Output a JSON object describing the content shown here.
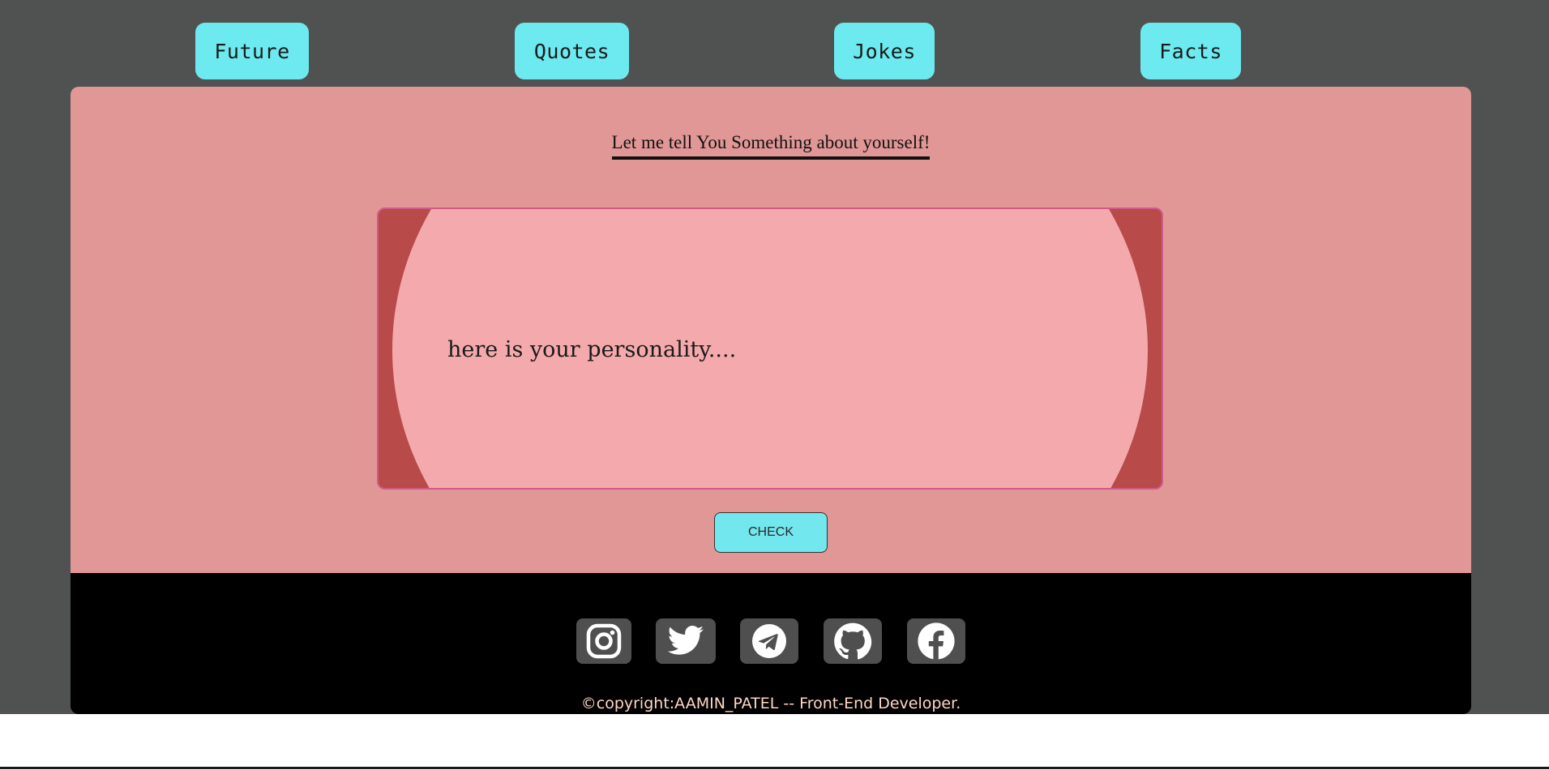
{
  "nav": {
    "items": [
      {
        "label": "Future"
      },
      {
        "label": "Quotes"
      },
      {
        "label": "Jokes"
      },
      {
        "label": "Facts"
      }
    ]
  },
  "main": {
    "heading": "Let me tell You Something about yourself!",
    "card_text": "here is your personality....",
    "check_label": "CHECK"
  },
  "footer": {
    "socials": [
      {
        "icon": "instagram-icon"
      },
      {
        "icon": "twitter-icon"
      },
      {
        "icon": "telegram-icon"
      },
      {
        "icon": "github-icon"
      },
      {
        "icon": "facebook-icon"
      }
    ],
    "copyright": "©copyright:AAMIN_PATEL -- Front-End Developer."
  },
  "colors": {
    "page_bg": "#505151",
    "nav_button": "#6ceaf0",
    "panel": "#e29797",
    "card_outer": "#b84a4a",
    "card_inner": "#f4aaac",
    "footer": "#000000",
    "copyright_text": "#ffd7c4"
  }
}
